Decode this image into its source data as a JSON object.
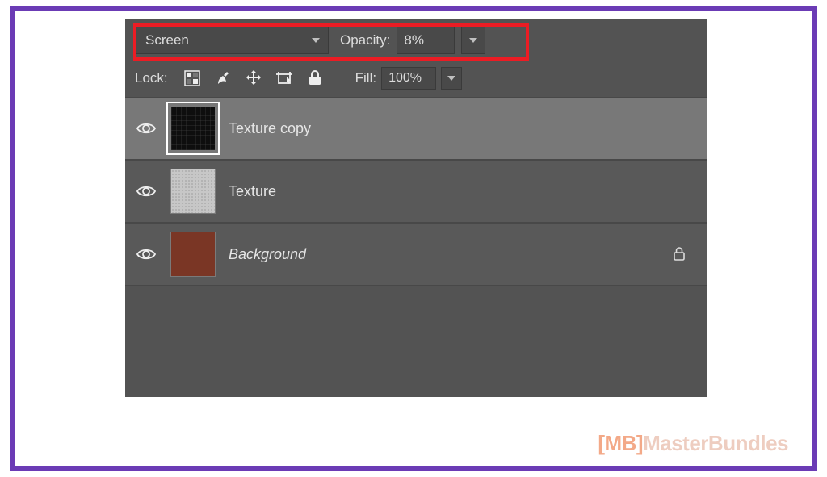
{
  "blend": {
    "mode": "Screen",
    "opacity_label": "Opacity:",
    "opacity_value": "8%"
  },
  "lock": {
    "label": "Lock:",
    "fill_label": "Fill:",
    "fill_value": "100%"
  },
  "layers": [
    {
      "name": "Texture copy",
      "selected": true,
      "locked": false,
      "italic": false,
      "thumb": "black"
    },
    {
      "name": "Texture",
      "selected": false,
      "locked": false,
      "italic": false,
      "thumb": "gray"
    },
    {
      "name": "Background",
      "selected": false,
      "locked": true,
      "italic": true,
      "thumb": "brown"
    }
  ],
  "watermark": {
    "bracket_open": "[",
    "mb": "MB",
    "bracket_close": "]",
    "text1": "Master",
    "text2": "Bundles"
  }
}
